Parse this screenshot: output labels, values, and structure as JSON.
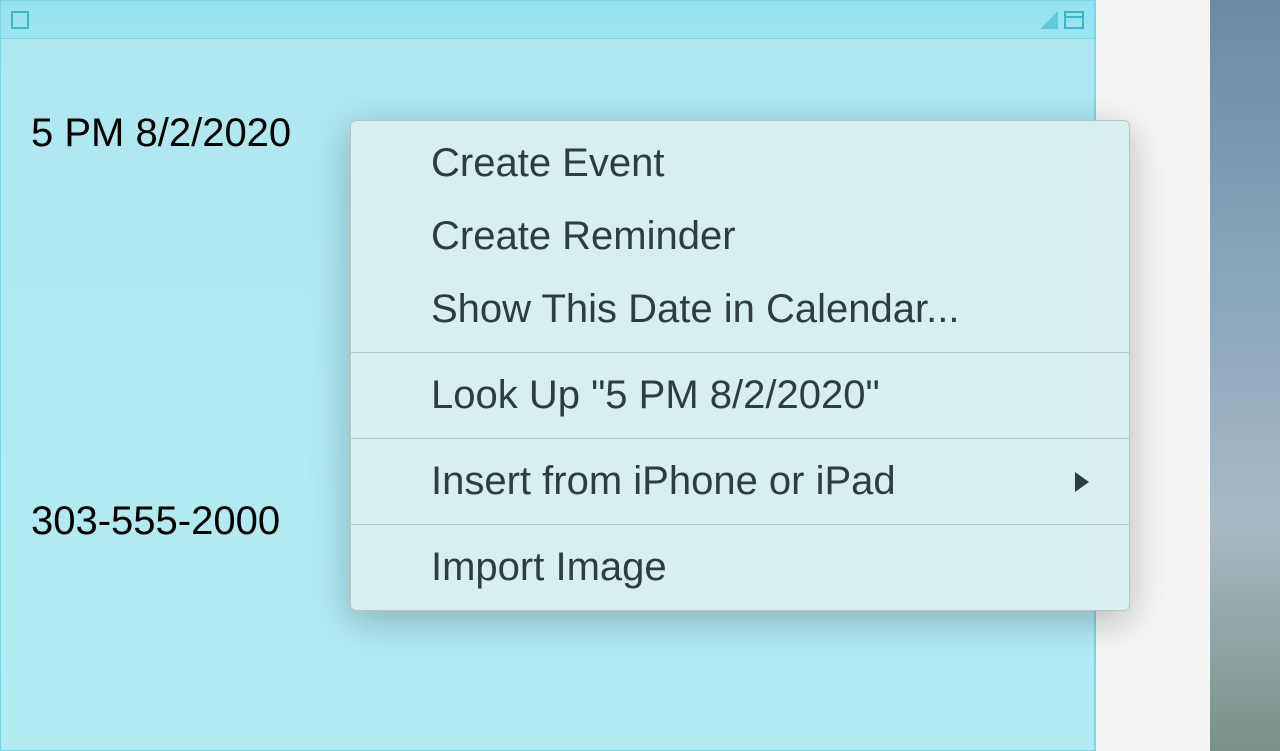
{
  "note": {
    "line1": "5 PM 8/2/2020",
    "line2": "303-555-2000"
  },
  "context_menu": {
    "items": [
      {
        "label": "Create Event",
        "has_submenu": false
      },
      {
        "label": "Create Reminder",
        "has_submenu": false
      },
      {
        "label": "Show This Date in Calendar...",
        "has_submenu": false
      }
    ],
    "lookup": {
      "label": "Look Up \"5 PM 8/2/2020\""
    },
    "insert": {
      "label": "Insert from iPhone or iPad"
    },
    "import": {
      "label": "Import Image"
    }
  },
  "icons": {
    "square": "square-icon",
    "triangle": "resize-icon",
    "window": "window-icon"
  }
}
